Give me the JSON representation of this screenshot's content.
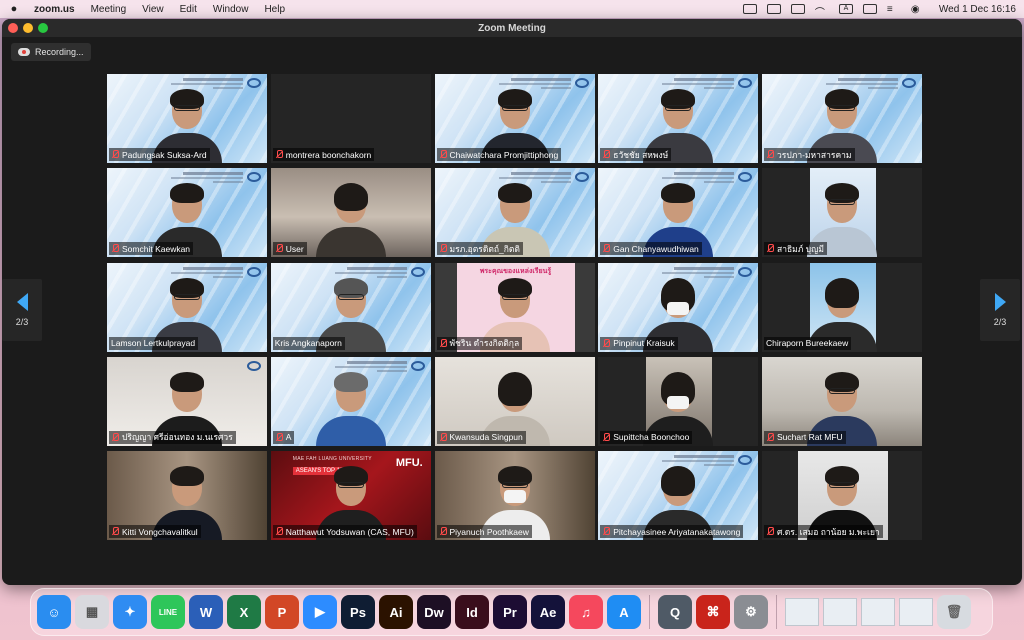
{
  "menubar": {
    "app": "zoom.us",
    "items": [
      "Meeting",
      "View",
      "Edit",
      "Window",
      "Help"
    ],
    "clock": "Wed 1 Dec  16:16",
    "keyboard": "A"
  },
  "window": {
    "title": "Zoom Meeting",
    "recording_label": "Recording...",
    "page_left": "2/3",
    "page_right": "2/3"
  },
  "colors": {
    "close": "#ff5f57",
    "minimize": "#febc2e",
    "zoom": "#28c840",
    "accent": "#3fa8f5",
    "muted": "#ff4b4b"
  },
  "participants": [
    {
      "name": "Padungsak Suksa-Ard",
      "muted": true
    },
    {
      "name": "montrera boonchakorn",
      "muted": true
    },
    {
      "name": "Chaiwatchara Promjittiphong",
      "muted": true
    },
    {
      "name": "ธวัชชัย สหพงษ์",
      "muted": true
    },
    {
      "name": "วรปภา-มหาสารคาม",
      "muted": true
    },
    {
      "name": "Somchit Kaewkan",
      "muted": true
    },
    {
      "name": "User",
      "muted": true
    },
    {
      "name": "มรภ.อุตรดิตถ์_กิตติ",
      "muted": true
    },
    {
      "name": "Gan Chanyawudhiwan",
      "muted": true
    },
    {
      "name": "สาธิมภ์ บุญมี",
      "muted": true
    },
    {
      "name": "Lamson Lertkulprayad",
      "muted": false
    },
    {
      "name": "Kris Angkanaporn",
      "muted": false
    },
    {
      "name": "พัชริน ดำรงกิตติกุล",
      "muted": true
    },
    {
      "name": "Pinpinut Kraisuk",
      "muted": true
    },
    {
      "name": "Chiraporn Bureekaew",
      "muted": false
    },
    {
      "name": "ปริญญา ศรีอ่อนทอง ม.นเรศวร",
      "muted": true
    },
    {
      "name": "A",
      "muted": true
    },
    {
      "name": "Kwansuda Singpun",
      "muted": true
    },
    {
      "name": "Supittcha Boonchoo",
      "muted": true
    },
    {
      "name": "Suchart Rat MFU",
      "muted": true
    },
    {
      "name": "Kitti Vongchavalitkul",
      "muted": true
    },
    {
      "name": "Natthawut Yodsuwan (CAS, MFU)",
      "muted": true
    },
    {
      "name": "Piyanuch Poothkaew",
      "muted": true
    },
    {
      "name": "Pitchayasinee Ariyatanakatawong",
      "muted": true
    },
    {
      "name": "ศ.ดร. เสมอ ถาน้อย ม.พะเยา",
      "muted": true
    }
  ],
  "tile_texts": {
    "pink_banner": "พระคุณของแหล่งเรียนรู้",
    "mfu_logo": "MFU.",
    "mfu_university": "MAE FAH LUANG UNIVERSITY",
    "mfu_rank": "ASEAN'S TOP 10"
  },
  "dock": {
    "apps": [
      {
        "name": "finder-icon",
        "glyph": "☺",
        "color": "#2a8df0"
      },
      {
        "name": "launchpad-icon",
        "glyph": "▦",
        "color": "#d9d9de"
      },
      {
        "name": "safari-icon",
        "glyph": "✦",
        "color": "#2f8cf2"
      },
      {
        "name": "line-icon",
        "glyph": "LINE",
        "color": "#2ec65a"
      },
      {
        "name": "word-icon",
        "glyph": "W",
        "color": "#2b5fb8"
      },
      {
        "name": "excel-icon",
        "glyph": "X",
        "color": "#1f7a45"
      },
      {
        "name": "powerpoint-icon",
        "glyph": "P",
        "color": "#d24726"
      },
      {
        "name": "zoom-icon",
        "glyph": "▶",
        "color": "#2d8cff"
      },
      {
        "name": "photoshop-icon",
        "glyph": "Ps",
        "color": "#0f1d33"
      },
      {
        "name": "illustrator-icon",
        "glyph": "Ai",
        "color": "#2b1200"
      },
      {
        "name": "dreamweaver-icon",
        "glyph": "Dw",
        "color": "#1d0f24"
      },
      {
        "name": "indesign-icon",
        "glyph": "Id",
        "color": "#3a0e1c"
      },
      {
        "name": "premiere-icon",
        "glyph": "Pr",
        "color": "#1d0c33"
      },
      {
        "name": "aftereffects-icon",
        "glyph": "Ae",
        "color": "#14123a"
      },
      {
        "name": "music-icon",
        "glyph": "♫",
        "color": "#f5485d"
      },
      {
        "name": "appstore-icon",
        "glyph": "A",
        "color": "#1f8df3"
      },
      {
        "name": "quicktime-icon",
        "glyph": "Q",
        "color": "#4f5a66"
      },
      {
        "name": "acrobat-icon",
        "glyph": "⌘",
        "color": "#c9241b"
      },
      {
        "name": "system-preferences-icon",
        "glyph": "⚙",
        "color": "#8a8d93"
      }
    ]
  }
}
